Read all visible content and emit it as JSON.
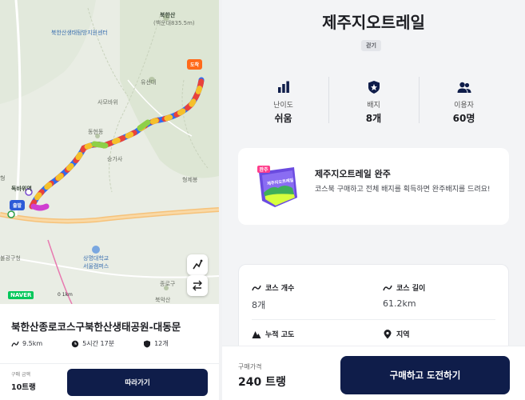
{
  "map": {
    "labels": {
      "peak": "북한산",
      "peak_sub": "(백운대835.5m)",
      "center": "북한산생태탐방지원센터",
      "yusendae": "유선대",
      "sawoohyeon": "사모바위",
      "donghyeon": "동현동",
      "seunggasa": "승가사",
      "hyeongjebong": "형제봉",
      "dokbawi": "독바위역",
      "bulgwang": "불광역",
      "gupa": "구파발",
      "sangmyung": "상명대학교\n서울캠퍼스",
      "jongno": "종로구",
      "bukak": "북악산",
      "bulgwang_gu": "불광구청",
      "hyeong": "형"
    },
    "pins": {
      "start": "출발",
      "end": "도착"
    },
    "naver": "NAVER",
    "scale": "0        1km",
    "icons": {
      "route_toggle": "route-icon",
      "swap": "swap-icon"
    }
  },
  "course": {
    "title": "북한산종로코스구북한산생태공원-대동문",
    "distance": "9.5km",
    "duration": "5시간 17분",
    "badge_count": "12개",
    "price_label": "구매 금액",
    "price": "10트랭",
    "follow_button": "따라가기"
  },
  "detail_page": {
    "title": "제주지오트레일",
    "tag": "걷기",
    "stats": [
      {
        "label": "난이도",
        "value": "쉬움",
        "icon": "bar-chart-icon"
      },
      {
        "label": "배지",
        "value": "8개",
        "icon": "badge-icon"
      },
      {
        "label": "이용자",
        "value": "60명",
        "icon": "users-icon"
      }
    ],
    "badge_card": {
      "ribbon": "완주",
      "flag_text": "제주지오트레일",
      "title": "제주지오트레일 완주",
      "description": "코스북 구매하고 전체 배지를 획득하면 완주배지를 드려요!"
    },
    "details": [
      {
        "label": "코스 개수",
        "value": "8개",
        "icon": "route-icon"
      },
      {
        "label": "코스 길이",
        "value": "61.2km",
        "icon": "route-icon"
      },
      {
        "label": "누적 고도",
        "value": "",
        "icon": "mountain-icon"
      },
      {
        "label": "지역",
        "value": "",
        "icon": "location-pin-icon"
      }
    ],
    "bottom": {
      "price_label": "구매가격",
      "price": "240 트랭",
      "buy_button": "구매하고 도전하기"
    }
  },
  "colors": {
    "primary": "#0f1d4a",
    "accent_orange": "#ff6a1a",
    "accent_blue": "#2d5bd8",
    "badge_purple": "#6b4be0"
  }
}
